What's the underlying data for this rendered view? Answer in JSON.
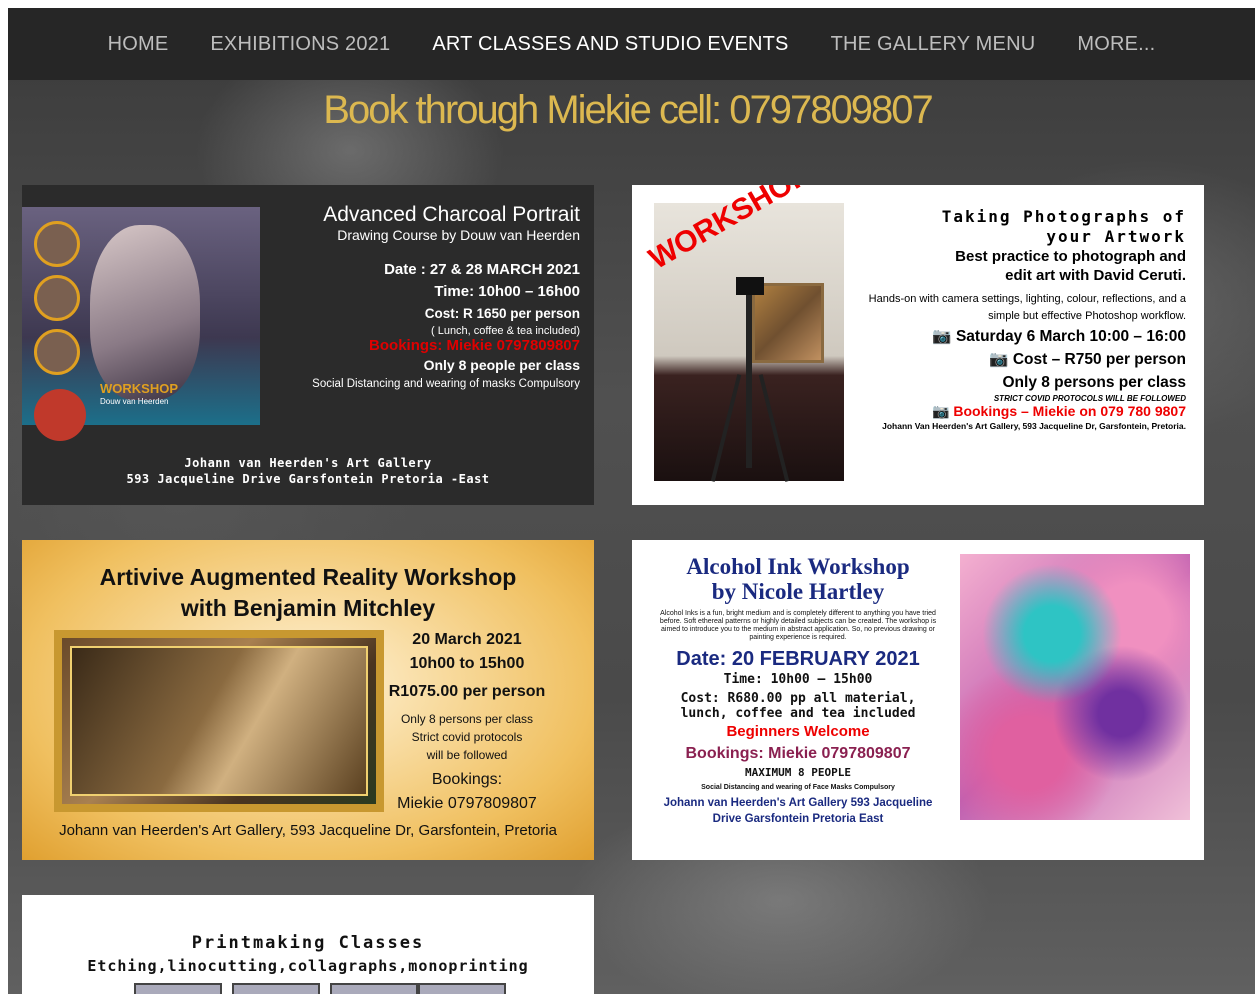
{
  "nav": {
    "items": [
      {
        "label": "HOME",
        "active": false
      },
      {
        "label": "EXHIBITIONS 2021",
        "active": false
      },
      {
        "label": "ART CLASSES AND STUDIO EVENTS",
        "active": true
      },
      {
        "label": "THE GALLERY MENU",
        "active": false
      },
      {
        "label": "MORE...",
        "active": false
      }
    ]
  },
  "booking_heading": "Book through Miekie cell: 0797809807",
  "colors": {
    "accent": "#dcb850",
    "nav_bg": "#262626",
    "red": "#e00000"
  },
  "cards": {
    "charcoal": {
      "workshop_label": "WORKSHOP",
      "author": "Douw van Heerden",
      "title": "Advanced Charcoal Portrait",
      "subtitle": "Drawing Course by Douw van Heerden",
      "date": "Date : 27 & 28 MARCH 2021",
      "time": "Time: 10h00 – 16h00",
      "cost": "Cost:  R 1650 per person",
      "includes": "( Lunch, coffee & tea included)",
      "bookings": "Bookings: Miekie 0797809807",
      "capacity": "Only 8 people per class",
      "notice": "Social Distancing and wearing of masks Compulsory",
      "venue": "Johann van Heerden's Art Gallery",
      "address": "593 Jacqueline Drive Garsfontein Pretoria -East"
    },
    "photography": {
      "workshop_label": "WORKSHOP",
      "title_line1": "Taking Photographs of",
      "title_line2": "your Artwork",
      "subtitle_line1": "Best practice to photograph and",
      "subtitle_line2": "edit art with David Ceruti.",
      "description": "Hands-on with camera settings, lighting, colour, reflections, and a simple but effective Photoshop workflow.",
      "date": "Saturday 6 March 10:00 – 16:00",
      "cost": "Cost – R750 per person",
      "capacity": "Only 8 persons per class",
      "covid": "STRICT COVID PROTOCOLS WILL BE FOLLOWED",
      "bookings": "Bookings – Miekie on 079 780 9807",
      "address": "Johann Van Heerden's Art Gallery, 593 Jacqueline Dr, Garsfontein, Pretoria."
    },
    "artivive": {
      "title_line1": "Artivive Augmented Reality Workshop",
      "title_line2": "with Benjamin Mitchley",
      "date": "20 March 2021",
      "time": "10h00 to 15h00",
      "cost": "R1075.00 per person",
      "capacity": "Only 8 persons per class",
      "covid_line1": "Strict covid protocols",
      "covid_line2": "will be followed",
      "bookings_label": "Bookings:",
      "bookings": "Miekie 0797809807",
      "address": "Johann van Heerden's Art Gallery, 593 Jacqueline Dr, Garsfontein, Pretoria"
    },
    "alcohol_ink": {
      "title_line1": "Alcohol Ink Workshop",
      "title_line2": "by Nicole Hartley",
      "description": "Alcohol Inks is a fun, bright medium and is completely different to anything you have tried before. Soft ethereal patterns or highly detailed subjects can be created. The workshop is aimed to introduce you to the medium in abstract application. So, no previous drawing or painting experience is required.",
      "date": "Date: 20 FEBRUARY 2021",
      "time": "Time: 10h00 – 15h00",
      "cost_line1": "Cost: R680.00 pp all material,",
      "cost_line2": "lunch, coffee and tea included",
      "welcome": "Beginners Welcome",
      "bookings": "Bookings: Miekie 0797809807",
      "capacity": "MAXIMUM 8 PEOPLE",
      "notice": "Social Distancing and wearing of Face Masks Compulsory",
      "address_line1": "Johann van Heerden's Art Gallery 593 Jacqueline",
      "address_line2": "Drive Garsfontein Pretoria East"
    },
    "printmaking": {
      "title": "Printmaking Classes",
      "subtitle": "Etching,linocutting,collagraphs,monoprinting"
    }
  }
}
